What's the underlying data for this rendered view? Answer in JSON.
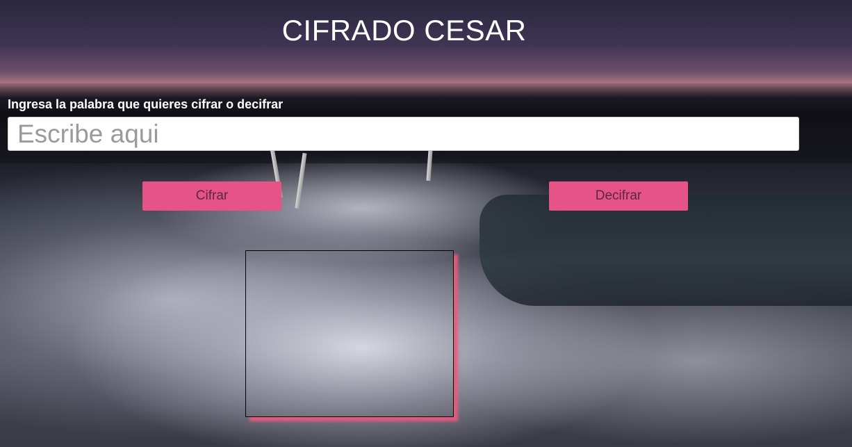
{
  "header": {
    "title": "CIFRADO CESAR"
  },
  "form": {
    "label": "Ingresa la palabra que quieres cifrar o decifrar",
    "input_placeholder": "Escribe aqui",
    "input_value": ""
  },
  "actions": {
    "encrypt_label": "Cifrar",
    "decrypt_label": "Decifrar"
  },
  "result": {
    "text": ""
  },
  "colors": {
    "button_bg": "#e55387",
    "result_shadow": "#e85a82",
    "text_primary": "#ffffff"
  }
}
